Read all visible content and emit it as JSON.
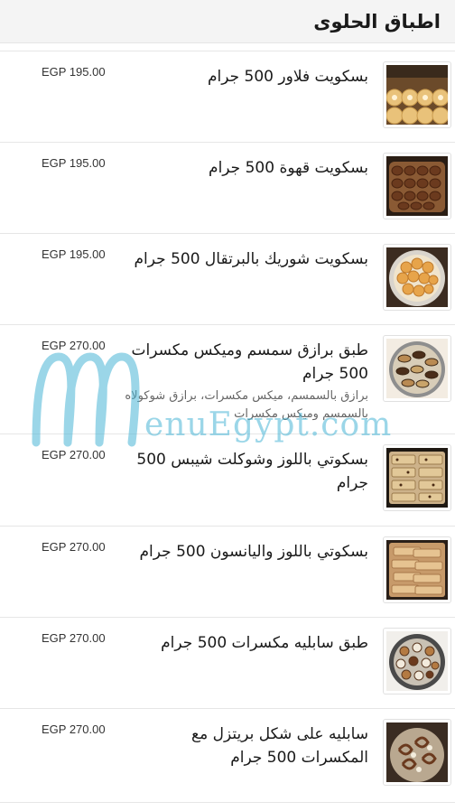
{
  "header": {
    "title": "اطباق الحلوى"
  },
  "items": [
    {
      "name": "بسكويت فلاور 500 جرام",
      "description": "",
      "price": "EGP 195.00",
      "icon": "biscuit-flower-photo"
    },
    {
      "name": "بسكويت قهوة 500 جرام",
      "description": "",
      "price": "EGP 195.00",
      "icon": "biscuit-coffee-photo"
    },
    {
      "name": "بسكويت شوريك بالبرتقال 500 جرام",
      "description": "",
      "price": "EGP 195.00",
      "icon": "biscuit-orange-photo"
    },
    {
      "name": "طبق برازق سمسم وميكس مكسرات 500 جرام",
      "description": "برازق بالسمسم، ميكس مكسرات، برازق شوكولاه بالسمسم وميكس مكسرات",
      "price": "EGP 270.00",
      "icon": "barazek-plate-photo"
    },
    {
      "name": "بسكوتي باللوز وشوكلت شيبس 500 جرام",
      "description": "",
      "price": "EGP 270.00",
      "icon": "biscotti-chocolate-photo"
    },
    {
      "name": "بسكوتي باللوز واليانسون 500 جرام",
      "description": "",
      "price": "EGP 270.00",
      "icon": "biscotti-anise-photo"
    },
    {
      "name": "طبق سابليه مكسرات 500 جرام",
      "description": "",
      "price": "EGP 270.00",
      "icon": "sable-nuts-plate-photo"
    },
    {
      "name": "سابليه على شكل بريتزل مع المكسرات 500 جرام",
      "description": "",
      "price": "EGP 270.00",
      "icon": "sable-pretzel-photo"
    }
  ],
  "watermark": {
    "text": "enuEgypt.com"
  },
  "colors": {
    "watermark": "#4ab6d6",
    "header_bg": "#f4f4f4"
  }
}
